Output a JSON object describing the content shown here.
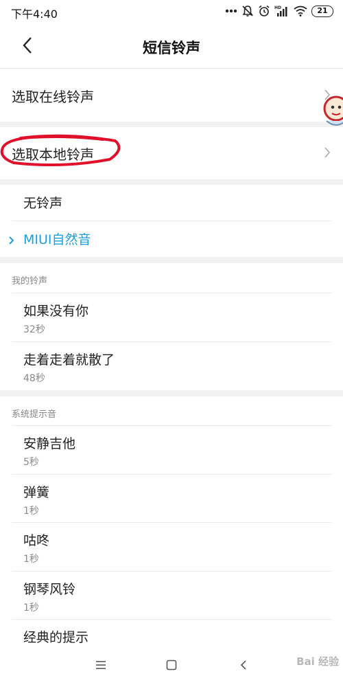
{
  "status_bar": {
    "time": "下午4:40",
    "battery": "21",
    "icons": [
      "more-icon",
      "mute-icon",
      "alarm-icon",
      "hd-signal-icon",
      "wifi-icon",
      "battery-icon"
    ]
  },
  "header": {
    "title": "短信铃声",
    "back_icon": "chevron-left-icon"
  },
  "entries": {
    "online": {
      "label": "选取在线铃声"
    },
    "local": {
      "label": "选取本地铃声"
    }
  },
  "options": {
    "none": "无铃声",
    "miui": "MIUI自然音"
  },
  "my_ringtones": {
    "header": "我的铃声",
    "items": [
      {
        "name": "如果没有你",
        "duration": "32秒"
      },
      {
        "name": "走着走着就散了",
        "duration": "48秒"
      }
    ]
  },
  "system_tones": {
    "header": "系统提示音",
    "items": [
      {
        "name": "安静吉他",
        "duration": "5秒"
      },
      {
        "name": "弹簧",
        "duration": "1秒"
      },
      {
        "name": "咕咚",
        "duration": "1秒"
      },
      {
        "name": "钢琴风铃",
        "duration": "1秒"
      },
      {
        "name": "经典的提示",
        "duration": ""
      }
    ]
  },
  "nav_bar": {
    "icons": [
      "menu-icon",
      "home-icon",
      "back-icon"
    ]
  },
  "watermark": {
    "text": "Bai 经验"
  },
  "colors": {
    "accent": "#1aa0e0",
    "highlight_circle": "#e0102a",
    "separator": "#f2f2f2"
  }
}
